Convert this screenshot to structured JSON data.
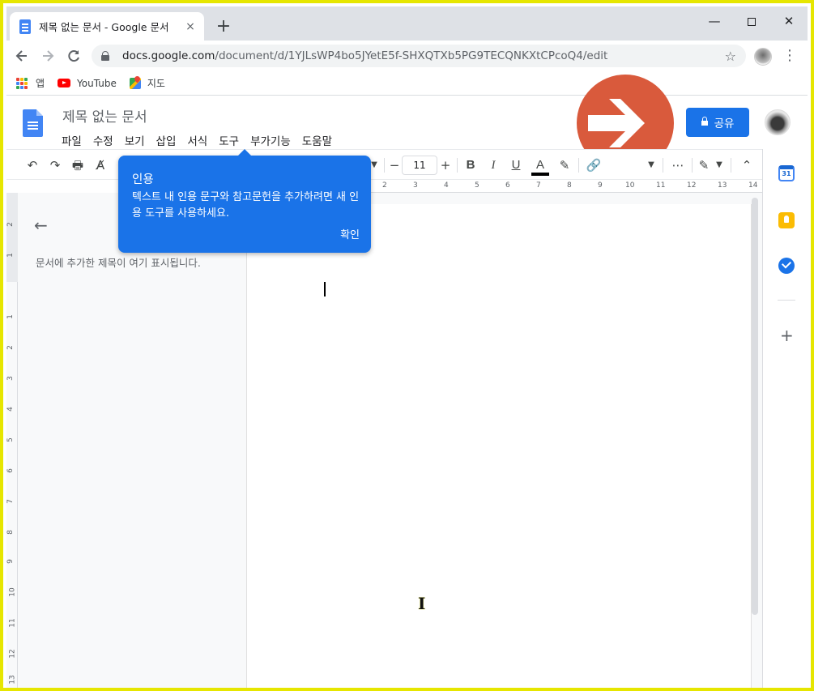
{
  "browser": {
    "tab_title": "제목 없는 문서 - Google 문서",
    "tab_close": "×",
    "new_tab": "+",
    "window_min": "—",
    "window_close": "✕",
    "url_host": "docs.google.com",
    "url_path": "/document/d/1YJLsWP4bo5JYetE5f-SHXQTXb5PG9TECQNKXtCPcoQ4/edit",
    "bookmarks": [
      {
        "label": "앱",
        "icon": "apps-grid-icon"
      },
      {
        "label": "YouTube",
        "icon": "youtube-icon"
      },
      {
        "label": "지도",
        "icon": "maps-icon"
      }
    ]
  },
  "docs": {
    "title": "제목 없는 문서",
    "menu": [
      "파일",
      "수정",
      "보기",
      "삽입",
      "서식",
      "도구",
      "부가기능",
      "도움말"
    ],
    "share_label": "공유",
    "font_size": "11",
    "outline_empty_text": "문서에 추가한 제목이 여기 표시됩니다."
  },
  "tooltip": {
    "title": "인용",
    "body": "텍스트 내 인용 문구와 참고문헌을 추가하려면 새 인용 도구를 사용하세요.",
    "ok": "확인"
  },
  "ruler": {
    "h_numbers": [
      "2",
      "3",
      "4",
      "5",
      "6",
      "7",
      "8",
      "9",
      "10",
      "11",
      "12",
      "13",
      "14"
    ],
    "v_numbers": [
      "2",
      "1",
      "1",
      "2",
      "3",
      "4",
      "5",
      "6",
      "7",
      "8",
      "9",
      "10",
      "11",
      "12",
      "13"
    ]
  },
  "side_panel": {
    "calendar_day": "31"
  },
  "colors": {
    "accent": "#1a73e8",
    "overlay_arrow": "#d95a3c",
    "frame_border": "#e6e600"
  }
}
